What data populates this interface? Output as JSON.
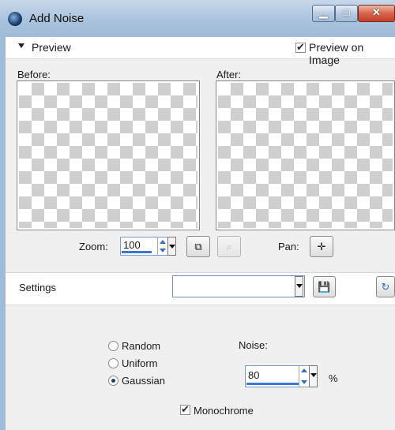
{
  "window": {
    "title": "Add Noise",
    "controls": {
      "minimize": "minimize",
      "maximize": "maximize",
      "close": "close"
    }
  },
  "preview": {
    "section_label": "Preview",
    "preview_on_image_label": "Preview on Image",
    "preview_on_image_checked": true,
    "before_label": "Before:",
    "after_label": "After:",
    "zoom_label": "Zoom:",
    "zoom_value": "100",
    "pan_label": "Pan:"
  },
  "settings": {
    "label": "Settings",
    "selected_preset": ""
  },
  "noise": {
    "distribution_options": [
      {
        "label": "Random",
        "selected": false
      },
      {
        "label": "Uniform",
        "selected": false
      },
      {
        "label": "Gaussian",
        "selected": true
      }
    ],
    "noise_label": "Noise:",
    "noise_value": "80",
    "unit": "%",
    "monochrome_label": "Monochrome",
    "monochrome_checked": true
  },
  "icons": {
    "app": "app-icon",
    "zoom_fit": "zoom-to-fit-icon",
    "zoom_disabled": "zoom-icon",
    "pan": "pan-icon",
    "save": "save-icon",
    "reset": "reset-icon"
  }
}
